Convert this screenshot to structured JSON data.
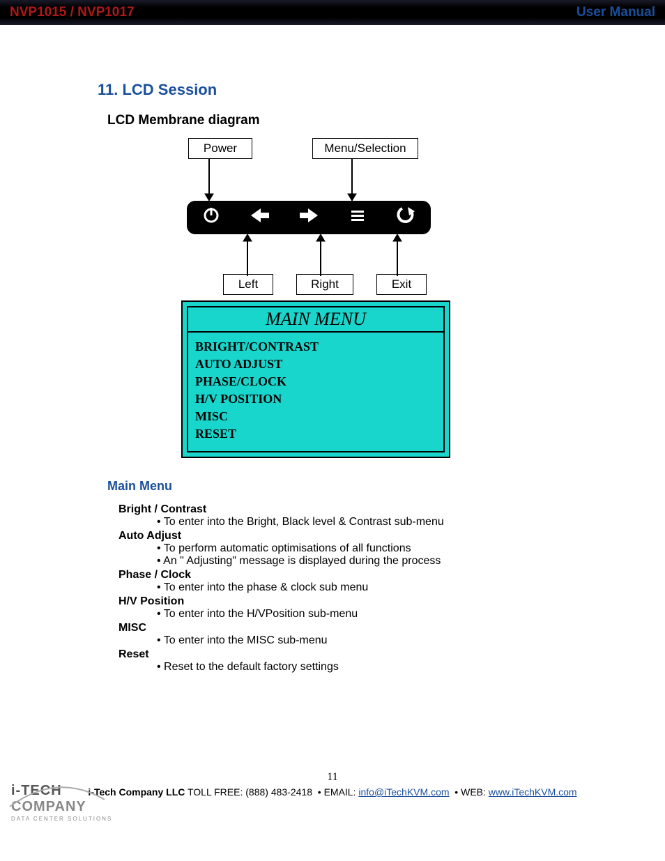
{
  "header": {
    "left": "NVP1015 / NVP1017",
    "right": "User Manual"
  },
  "section_title": "11. LCD Session",
  "diagram_title": "LCD Membrane diagram",
  "diagram_labels": {
    "power": "Power",
    "menu": "Menu/Selection",
    "left": "Left",
    "right": "Right",
    "exit": "Exit"
  },
  "lcd": {
    "title": "MAIN MENU",
    "items": [
      "BRIGHT/CONTRAST",
      "AUTO ADJUST",
      "PHASE/CLOCK",
      "H/V POSITION",
      "MISC",
      "RESET"
    ]
  },
  "main_menu_heading": "Main Menu",
  "definitions": [
    {
      "term": "Bright / Contrast",
      "bullets": [
        "To enter into the Bright, Black level & Contrast sub-menu"
      ]
    },
    {
      "term": "Auto Adjust",
      "bullets": [
        "To perform automatic optimisations of all functions",
        "An \" Adjusting\" message is displayed during the process"
      ]
    },
    {
      "term": "Phase / Clock",
      "bullets": [
        "To enter into the phase & clock sub menu"
      ]
    },
    {
      "term": "H/V Position",
      "bullets": [
        "To enter into the H/VPosition sub-menu"
      ]
    },
    {
      "term": "MISC",
      "bullets": [
        "To enter into the MISC sub-menu"
      ]
    },
    {
      "term": "Reset",
      "bullets": [
        "Reset to the default factory settings"
      ]
    }
  ],
  "footer": {
    "page_number": "11",
    "company_bold": "i-Tech Company LLC",
    "tollfree_label": " TOLL FREE: ",
    "tollfree": "(888) 483-2418",
    "email_label": "EMAIL: ",
    "email": "info@iTechKVM.com",
    "web_label": "WEB: ",
    "web": "www.iTechKVM.com",
    "logo_top": "i-TECH",
    "logo_mid": "COMPANY",
    "logo_sub": "DATA CENTER SOLUTIONS"
  }
}
